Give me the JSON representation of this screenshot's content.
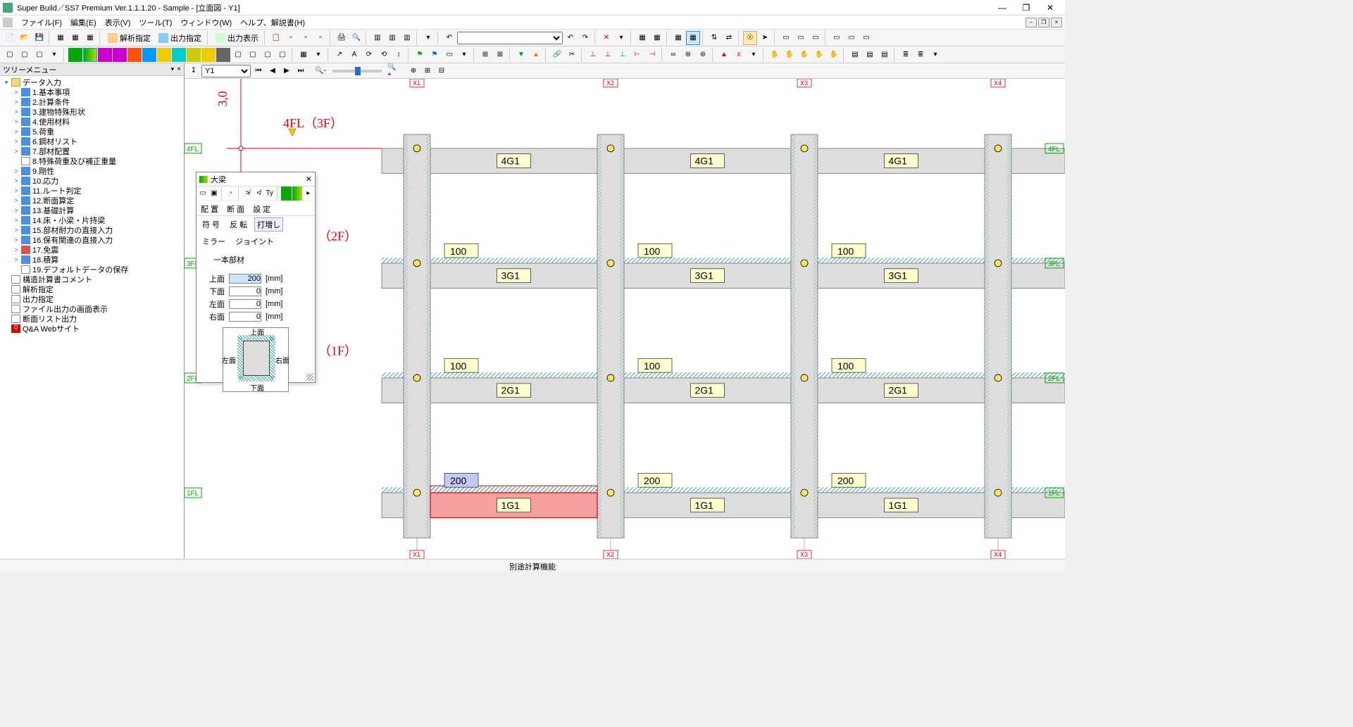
{
  "title": "Super Build／SS7 Premium  Ver.1.1.1.20 - Sample - [立面図 - Y1]",
  "menubar": [
    "ファイル(F)",
    "編集(E)",
    "表示(V)",
    "ツール(T)",
    "ウィンドウ(W)",
    "ヘルプ、解説書(H)"
  ],
  "toolbar1_text": [
    "解析指定",
    "出力指定",
    "出力表示"
  ],
  "tree_header": "ツリーメニュー",
  "tree_root": "データ入力",
  "tree_items": [
    "1.基本事項",
    "2.計算条件",
    "3.建物特殊形状",
    "4.使用材料",
    "5.荷重",
    "6.鋼材リスト",
    "7.部材配置",
    "8.特殊荷重及び補正重量",
    "9.剛性",
    "10.応力",
    "11.ルート判定",
    "12.断面算定",
    "13.基礎計算",
    "14.床・小梁・片持梁",
    "15.部材耐力の直接入力",
    "16.保有関連の直接入力",
    "17.免震",
    "18.積算",
    "19.デフォルトデータの保存"
  ],
  "tree_extra": [
    "構造計算書コメント",
    "解析指定",
    "出力指定",
    "ファイル出力の画面表示",
    "断面リスト出力",
    "Q&A Webサイト"
  ],
  "bottom_button": "別途計算機能",
  "canvas_selector": "Y1",
  "floors": {
    "f4": "4FL",
    "f3": "3FL",
    "f2": "2FL",
    "f1": "1FL"
  },
  "floor_red": {
    "l4": "4FL（3F）",
    "l3": "（2F）",
    "l2": "（1F）",
    "sidetext": "3,0"
  },
  "x_markers": [
    "X1",
    "X2",
    "X3",
    "X4"
  ],
  "beams": {
    "row4": [
      "4G1",
      "4G1",
      "4G1"
    ],
    "row3": [
      "3G1",
      "3G1",
      "3G1"
    ],
    "row2": [
      "2G1",
      "2G1",
      "2G1"
    ],
    "row1": [
      "1G1",
      "1G1",
      "1G1"
    ]
  },
  "offsets": {
    "row3": [
      "100",
      "100",
      "100"
    ],
    "row2": [
      "100",
      "100",
      "100"
    ],
    "row1": [
      "200",
      "200",
      "200"
    ]
  },
  "dialog": {
    "title": "大梁",
    "tabs": [
      "配 置",
      "断 面",
      "設 定"
    ],
    "subtabs_row1": [
      "符 号",
      "反 転",
      "打増し"
    ],
    "subtabs_row2": [
      "ミラー",
      "ジョイント",
      "一本部材"
    ],
    "fields": {
      "top_lbl": "上面",
      "top_val": "200",
      "bot_lbl": "下面",
      "bot_val": "0",
      "left_lbl": "左面",
      "left_val": "0",
      "right_lbl": "右面",
      "right_val": "0",
      "unit": "[mm]"
    },
    "preview_labels": {
      "top": "上面",
      "bottom": "下面",
      "left": "左面",
      "right": "右面"
    }
  }
}
